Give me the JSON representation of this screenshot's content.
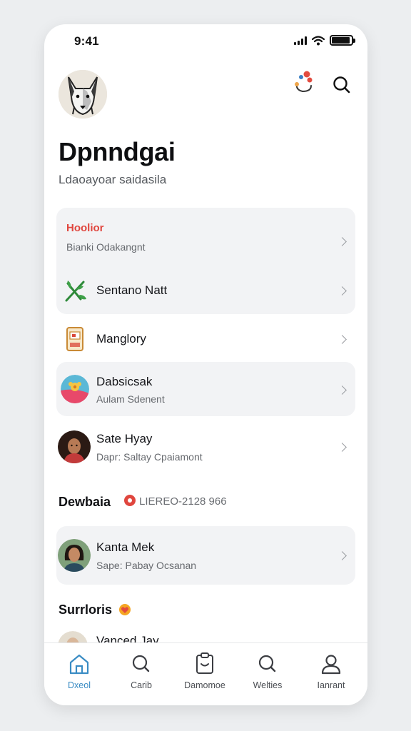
{
  "status_bar": {
    "time": "9:41"
  },
  "header": {
    "title": "Dpnndgai",
    "subtitle": "Ldaoayoar saidasila",
    "icons": [
      "avatar",
      "connections-icon",
      "search-icon"
    ]
  },
  "list_items": [
    {
      "title": "Hoolior",
      "subtitle": "Bianki Odakangnt",
      "title_color": "#e0463e"
    },
    {
      "title": "Sentano Natt",
      "icon": "leaf-icon"
    },
    {
      "title": "Manglory",
      "icon": "card-icon"
    },
    {
      "title": "Dabsicsak",
      "subtitle": "Aulam Sdenent",
      "icon": "flower-icon"
    },
    {
      "title": "Sate Hyay",
      "subtitle": "Dapr: Saltay Cpaiamont",
      "icon": "avatar"
    }
  ],
  "section_1": {
    "title": "Dewbaia",
    "badge_text": "LIEREO-2128 966",
    "items": [
      {
        "title": "Kanta Mek",
        "subtitle": "Sape: Pabay Ocsanan"
      }
    ]
  },
  "section_2": {
    "title": "Surrloris",
    "items": [
      {
        "title": "Vanced Jay"
      }
    ]
  },
  "tabs": [
    {
      "label": "Dxeol",
      "icon": "home-icon",
      "active": true
    },
    {
      "label": "Carib",
      "icon": "search-icon",
      "active": false
    },
    {
      "label": "Damomoe",
      "icon": "document-icon",
      "active": false
    },
    {
      "label": "Welties",
      "icon": "search-icon",
      "active": false
    },
    {
      "label": "Ianrant",
      "icon": "profile-icon",
      "active": false
    }
  ],
  "colors": {
    "accent": "#3a8cc4",
    "alert": "#e0463e",
    "card_bg": "#f2f3f5"
  }
}
